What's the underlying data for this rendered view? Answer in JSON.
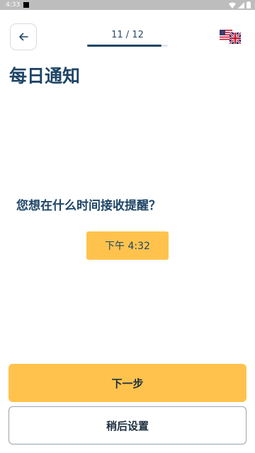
{
  "status_bar": {
    "time": "4:33"
  },
  "header": {
    "back_icon": "arrow-left-icon",
    "progress_label": "11 / 12",
    "progress_fraction": 0.917,
    "language_icon": "us-uk-flag-icon"
  },
  "main": {
    "title": "每日通知",
    "question": "您想在什么时间接收提醒？",
    "time_value": "下午 4:32"
  },
  "footer": {
    "next_label": "下一步",
    "later_label": "稍后设置"
  },
  "colors": {
    "accent": "#ffc34d",
    "primary_text": "#1e4566",
    "status_bar": "#bdbdbd"
  }
}
